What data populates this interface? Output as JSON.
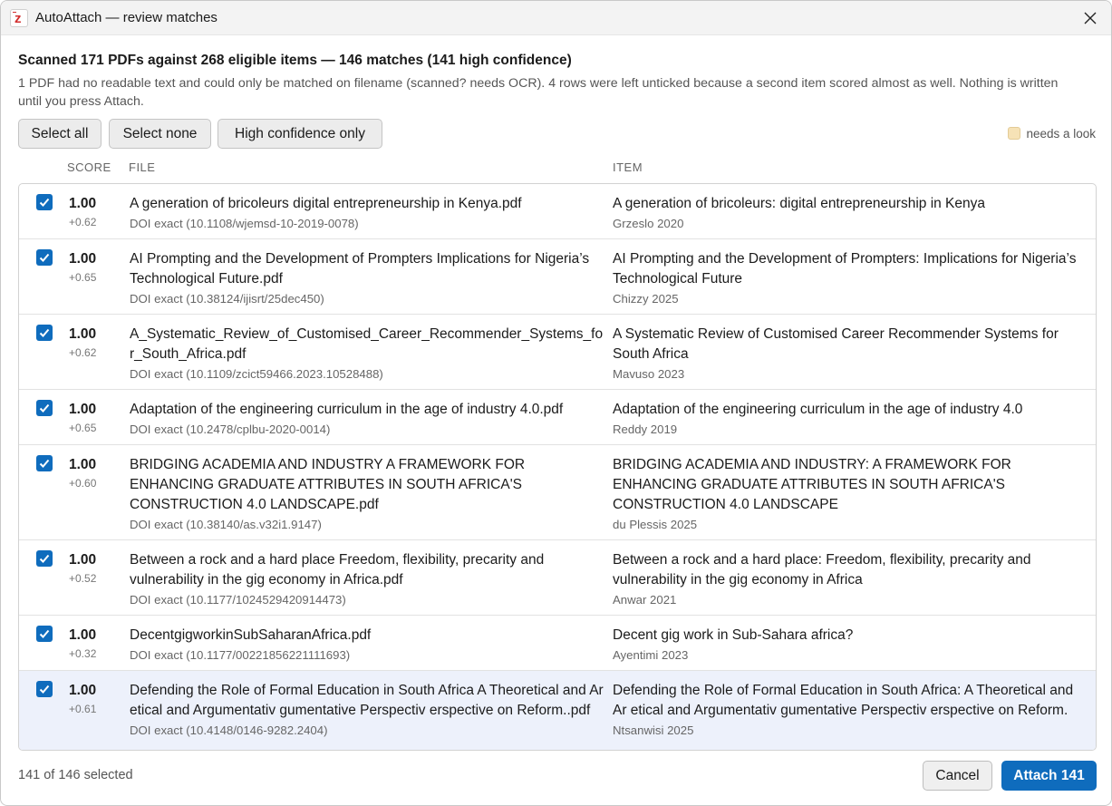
{
  "window": {
    "title": "AutoAttach — review matches"
  },
  "summary": {
    "title": "Scanned 171 PDFs against 268 eligible items — 146 matches (141 high confidence)",
    "description": "1 PDF had no readable text and could only be matched on filename (scanned? needs OCR). 4 rows were left unticked because a second item scored almost as well. Nothing is written until you press Attach."
  },
  "toolbar": {
    "select_all_label": "Select all",
    "select_none_label": "Select none",
    "high_conf_label": "High confidence only",
    "legend_label": "needs a look"
  },
  "columns": {
    "score": "SCORE",
    "file": "FILE",
    "item": "ITEM"
  },
  "rows": [
    {
      "checked": true,
      "score": "1.00",
      "delta": "+0.62",
      "file": "A generation of bricoleurs digital entrepreneurship in Kenya.pdf",
      "match": "DOI exact (10.1108/wjemsd-10-2019-0078)",
      "item": "A generation of bricoleurs: digital entrepreneurship in Kenya",
      "meta": "Grzeslo 2020"
    },
    {
      "checked": true,
      "score": "1.00",
      "delta": "+0.65",
      "file": "AI Prompting and the Development of Prompters Implications for Nigeria’s Technological Future.pdf",
      "match": "DOI exact (10.38124/ijisrt/25dec450)",
      "item": "AI Prompting and the Development of Prompters: Implications for Nigeria’s Technological Future",
      "meta": "Chizzy 2025"
    },
    {
      "checked": true,
      "score": "1.00",
      "delta": "+0.62",
      "file": "A_Systematic_Review_of_Customised_Career_Recommender_Systems_for_South_Africa.pdf",
      "match": "DOI exact (10.1109/zcict59466.2023.10528488)",
      "item": "A Systematic Review of Customised Career Recommender Systems for South Africa",
      "meta": "Mavuso 2023"
    },
    {
      "checked": true,
      "score": "1.00",
      "delta": "+0.65",
      "file": "Adaptation of the engineering curriculum in the age of industry 4.0.pdf",
      "match": "DOI exact (10.2478/cplbu-2020-0014)",
      "item": "Adaptation of the engineering curriculum in the age of industry 4.0",
      "meta": "Reddy 2019"
    },
    {
      "checked": true,
      "score": "1.00",
      "delta": "+0.60",
      "file": "BRIDGING ACADEMIA AND INDUSTRY A FRAMEWORK FOR ENHANCING GRADUATE ATTRIBUTES IN SOUTH AFRICA'S CONSTRUCTION 4.0 LANDSCAPE.pdf",
      "match": "DOI exact (10.38140/as.v32i1.9147)",
      "item": "BRIDGING ACADEMIA AND INDUSTRY: A FRAMEWORK FOR ENHANCING GRADUATE ATTRIBUTES IN SOUTH AFRICA'S CONSTRUCTION 4.0 LANDSCAPE",
      "meta": "du Plessis 2025"
    },
    {
      "checked": true,
      "score": "1.00",
      "delta": "+0.52",
      "file": "Between a rock and a hard place Freedom, flexibility, precarity and vulnerability in the gig economy in Africa.pdf",
      "match": "DOI exact (10.1177/1024529420914473)",
      "item": "Between a rock and a hard place: Freedom, flexibility, precarity and vulnerability in the gig economy in Africa",
      "meta": "Anwar 2021"
    },
    {
      "checked": true,
      "score": "1.00",
      "delta": "+0.32",
      "file": "DecentgigworkinSubSaharanAfrica.pdf",
      "match": "DOI exact (10.1177/00221856221111693)",
      "item": "Decent gig work in Sub-Sahara africa?",
      "meta": "Ayentimi 2023"
    },
    {
      "checked": true,
      "score": "1.00",
      "delta": "+0.61",
      "file": "Defending the Role of Formal Education in South Africa A Theoretical and Ar etical and Argumentativ gumentative Perspectiv erspective on Reform..pdf",
      "match": "DOI exact (10.4148/0146-9282.2404)",
      "item": "Defending the Role of Formal Education in South Africa: A Theoretical and Ar etical and Argumentativ gumentative Perspectiv erspective on Reform.",
      "meta": "Ntsanwisi 2025"
    }
  ],
  "footer": {
    "selected_count": "141 of 146 selected",
    "cancel_label": "Cancel",
    "attach_label": "Attach 141"
  },
  "colors": {
    "accent": "#0f6cbd",
    "legend_needs_look": "#f6e2b6",
    "selected_row": "#edf1fb"
  },
  "icons": {
    "app": "zotero-icon",
    "close": "close-icon",
    "check": "checkmark-icon"
  }
}
